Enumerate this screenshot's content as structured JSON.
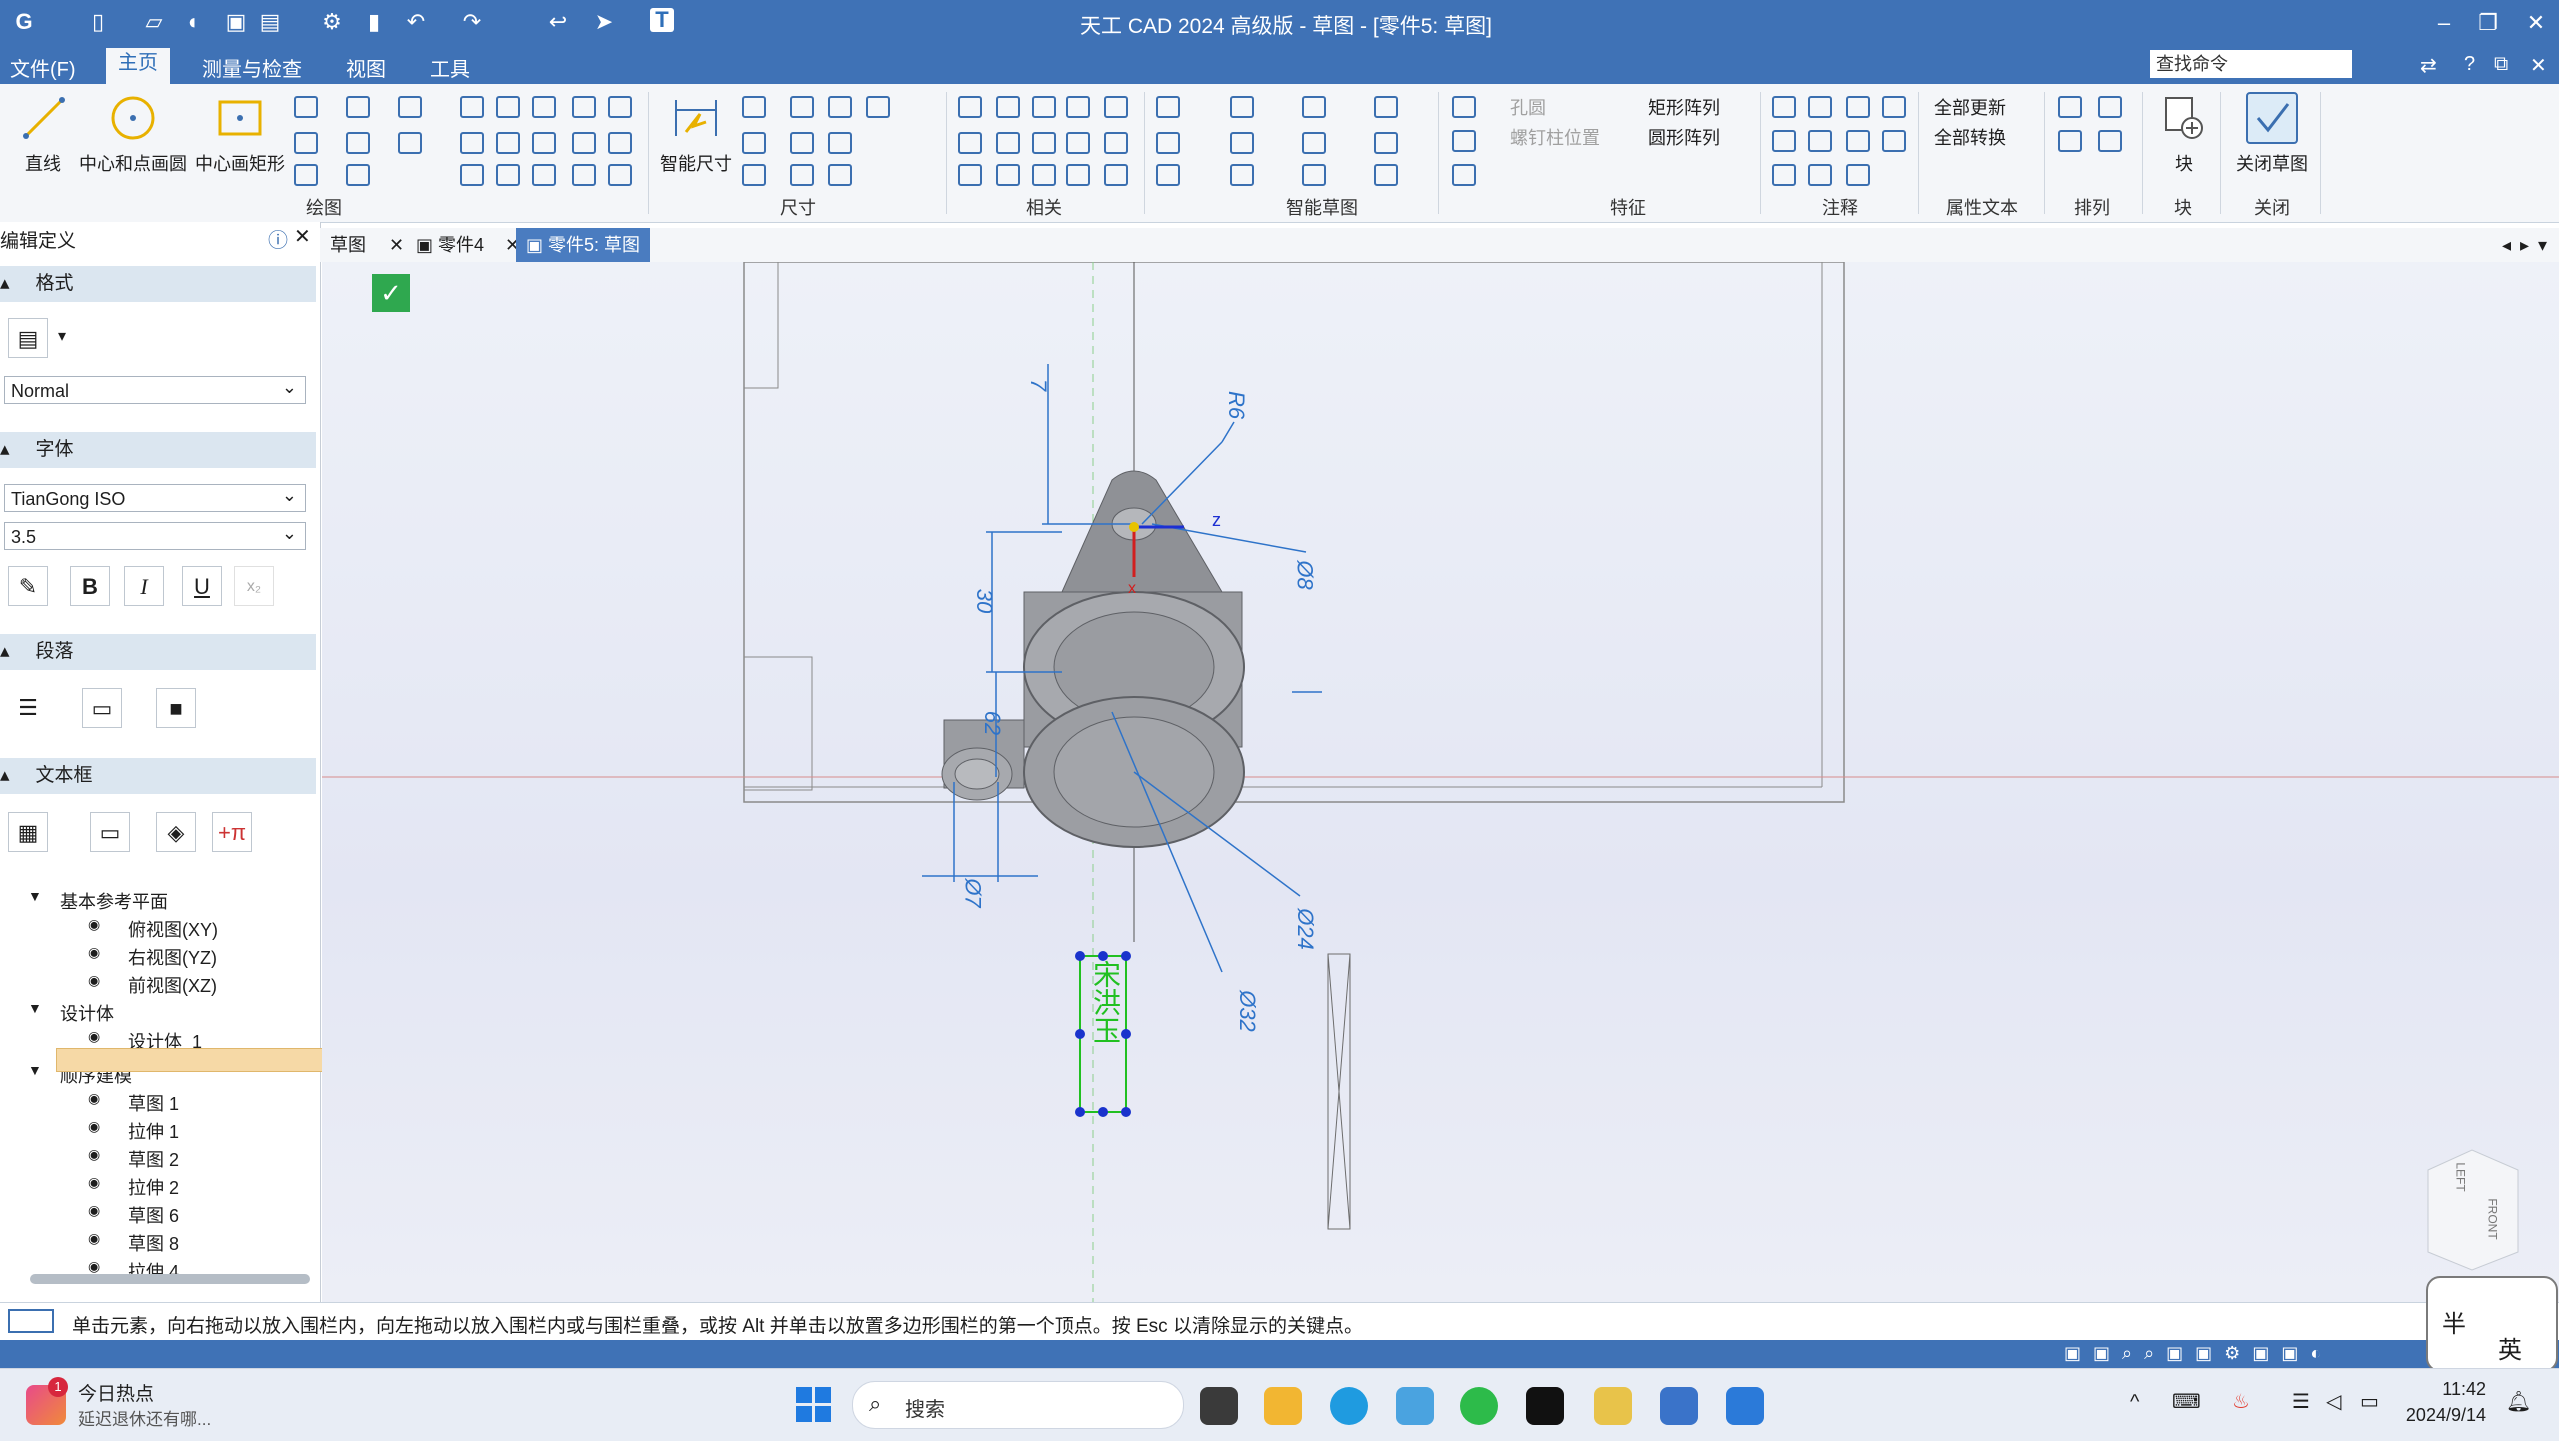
{
  "titlebar": {
    "title": "天工 CAD 2024 高级版 - 草图 - [零件5: 草图]",
    "minimize": "–",
    "restore": "❐",
    "close": "✕"
  },
  "menubar": {
    "items": [
      "文件(F)",
      "主页",
      "测量与检查",
      "视图",
      "工具"
    ],
    "search_placeholder": "查找命令",
    "help": "?"
  },
  "ribbon": {
    "draw": {
      "line": "直线",
      "circle": "中心和点画圆",
      "rect": "中心画矩形",
      "group": "绘图"
    },
    "dimension": {
      "smart": "智能尺寸",
      "group": "尺寸"
    },
    "relate": {
      "group": "相关"
    },
    "smart_sketch": {
      "group": "智能草图"
    },
    "feature": {
      "hole": "孔圆",
      "screw": "螺钉柱位置",
      "rect_array": "矩形阵列",
      "circ_array": "圆形阵列",
      "group": "特征"
    },
    "annotation": {
      "group": "注释"
    },
    "attr_text": {
      "update_all": "全部更新",
      "convert_all": "全部转换",
      "group": "属性文本"
    },
    "arrange": {
      "group": "排列"
    },
    "block": {
      "label": "块",
      "group": "块"
    },
    "close": {
      "label": "关闭草图",
      "group": "关闭"
    }
  },
  "left_panel": {
    "title": "编辑定义",
    "format_section": "格式",
    "style_value": "Normal",
    "font_section": "字体",
    "font_value": "TianGong ISO",
    "size_value": "3.5",
    "bold": "B",
    "italic": "I",
    "underline": "U",
    "paragraph_section": "段落",
    "textbox_section": "文本框",
    "tree": [
      {
        "label": "基本参考平面",
        "level": 1
      },
      {
        "label": "俯视图(XY)",
        "level": 2
      },
      {
        "label": "右视图(YZ)",
        "level": 2
      },
      {
        "label": "前视图(XZ)",
        "level": 2
      },
      {
        "label": "设计体",
        "level": 1
      },
      {
        "label": "设计体_1",
        "level": 2
      },
      {
        "label": "顺序建模",
        "level": 1
      },
      {
        "label": "草图 1",
        "level": 2
      },
      {
        "label": "拉伸 1",
        "level": 2
      },
      {
        "label": "草图 2",
        "level": 2
      },
      {
        "label": "拉伸 2",
        "level": 2
      },
      {
        "label": "草图 6",
        "level": 2
      },
      {
        "label": "草图 8",
        "level": 2
      },
      {
        "label": "拉伸 4",
        "level": 2
      }
    ]
  },
  "doc_tabs": [
    "草图",
    "零件4",
    "零件5: 草图"
  ],
  "dimensions": {
    "d7": "7",
    "r6": "R6",
    "d8": "Ø8",
    "d30": "30",
    "d62": "62",
    "d7b": "Ø7",
    "d24": "Ø24",
    "d32": "Ø32",
    "axis_z": "z",
    "axis_x": "x"
  },
  "sketch_text": "宋洪玉",
  "view_cube": {
    "left": "LEFT",
    "front": "FRONT"
  },
  "status": {
    "message": "单击元素，向右拖动以放入围栏内，向左拖动以放入围栏内或与围栏重叠，或按 Alt 并单击以放置多边形围栏的第一个顶点。按 Esc 以清除显示的关键点。"
  },
  "ime": {
    "half": "半",
    "lang": "英"
  },
  "taskbar": {
    "news_title": "今日热点",
    "news_sub": "延迟退休还有哪...",
    "badge": "1",
    "search": "搜索",
    "time": "11:42",
    "date": "2024/9/14"
  }
}
